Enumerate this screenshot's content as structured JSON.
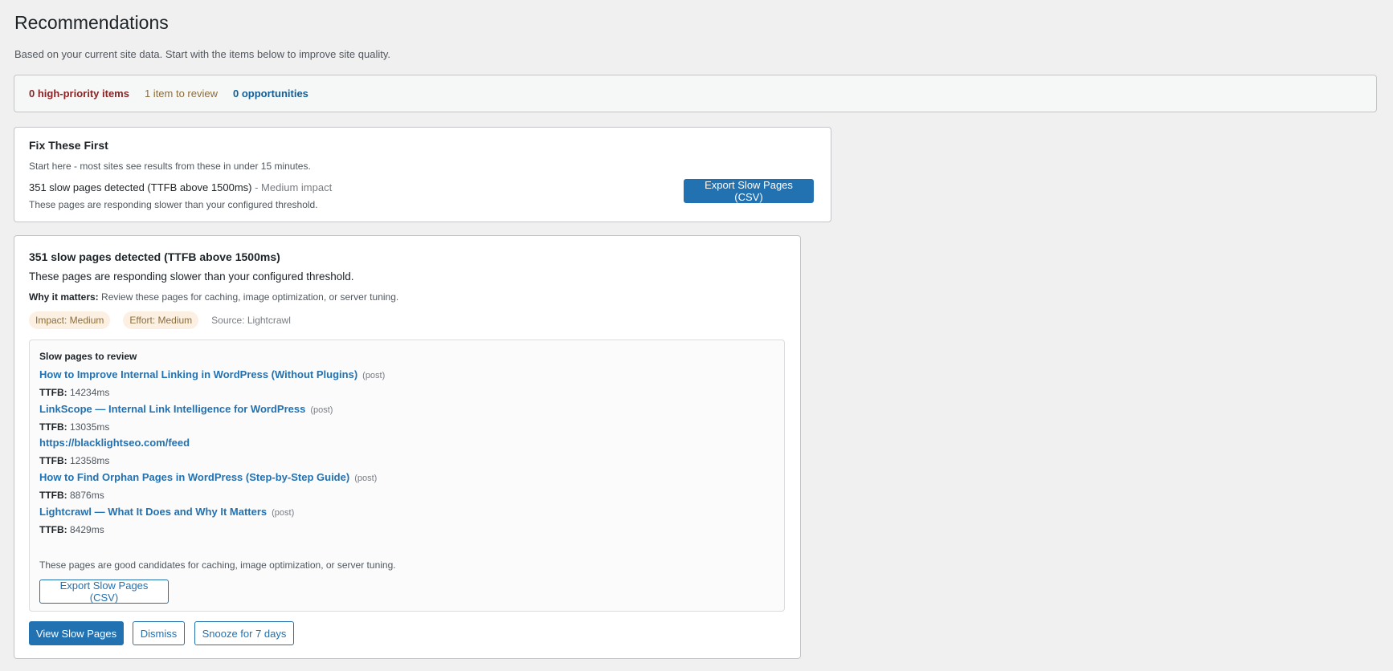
{
  "header": {
    "title": "Recommendations",
    "intro": "Based on your current site data. Start with the items below to improve site quality."
  },
  "summary": {
    "high_priority": "0 high-priority items",
    "to_review": "1 item to review",
    "opportunities": "0 opportunities"
  },
  "fix_first": {
    "title": "Fix These First",
    "subtitle": "Start here - most sites see results from these in under 15 minutes.",
    "issue_title": "351 slow pages detected (TTFB above 1500ms)",
    "issue_impact": " - Medium impact",
    "issue_desc": "These pages are responding slower than your configured threshold.",
    "export_label": "Export Slow Pages (CSV)"
  },
  "detail": {
    "title": "351 slow pages detected (TTFB above 1500ms)",
    "desc": "These pages are responding slower than your configured threshold.",
    "why_label": "Why it matters:",
    "why_text": " Review these pages for caching, image optimization, or server tuning.",
    "impact_tag": "Impact: Medium",
    "effort_tag": "Effort: Medium",
    "source": "Source: Lightcrawl",
    "panel_heading": "Slow pages to review",
    "ttfb_label": "TTFB:",
    "pages": [
      {
        "title": "How to Improve Internal Linking in WordPress (Without Plugins)",
        "type": "(post)",
        "ttfb": "14234ms"
      },
      {
        "title": "LinkScope — Internal Link Intelligence for WordPress",
        "type": "(post)",
        "ttfb": "13035ms"
      },
      {
        "title": "https://blacklightseo.com/feed",
        "type": "",
        "ttfb": "12358ms"
      },
      {
        "title": "How to Find Orphan Pages in WordPress (Step-by-Step Guide)",
        "type": "(post)",
        "ttfb": "8876ms"
      },
      {
        "title": "Lightcrawl — What It Does and Why It Matters",
        "type": "(post)",
        "ttfb": "8429ms"
      }
    ],
    "panel_note": "These pages are good candidates for caching, image optimization, or server tuning.",
    "export_label": "Export Slow Pages (CSV)",
    "view_label": "View Slow Pages",
    "dismiss_label": "Dismiss",
    "snooze_label": "Snooze for 7 days"
  }
}
